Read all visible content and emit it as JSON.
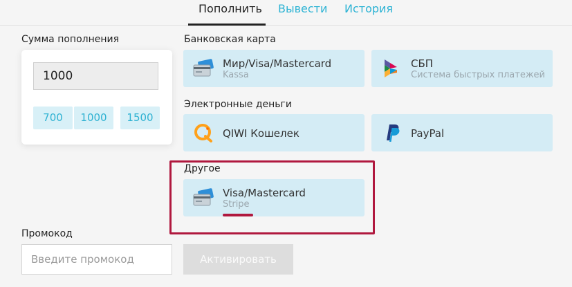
{
  "tabs": [
    {
      "label": "Пополнить",
      "active": true
    },
    {
      "label": "Вывести",
      "active": false
    },
    {
      "label": "История",
      "active": false
    }
  ],
  "amount": {
    "label": "Сумма пополнения",
    "value": "1000",
    "quick_options": [
      "700",
      "1000",
      "1500"
    ]
  },
  "bank_card": {
    "label": "Банковская карта",
    "methods": [
      {
        "title": "Мир/Visa/Mastercard",
        "subtitle": "Kassa",
        "icon": "credit-card-icon"
      },
      {
        "title": "СБП",
        "subtitle": "Система быстрых платежей",
        "icon": "sbp-icon"
      }
    ]
  },
  "e_money": {
    "label": "Электронные деньги",
    "methods": [
      {
        "title": "QIWI Кошелек",
        "icon": "qiwi-icon"
      },
      {
        "title": "PayPal",
        "icon": "paypal-icon"
      }
    ]
  },
  "other": {
    "label": "Другое",
    "methods": [
      {
        "title": "Visa/Mastercard",
        "subtitle": "Stripe",
        "icon": "credit-card-icon"
      }
    ]
  },
  "promo": {
    "label": "Промокод",
    "placeholder": "Введите промокод",
    "button_label": "Активировать"
  },
  "colors": {
    "accent": "#2cb3d4",
    "method_bg": "#d4ecf5",
    "highlight": "#b0183e",
    "page_bg": "#f5f5f5"
  }
}
